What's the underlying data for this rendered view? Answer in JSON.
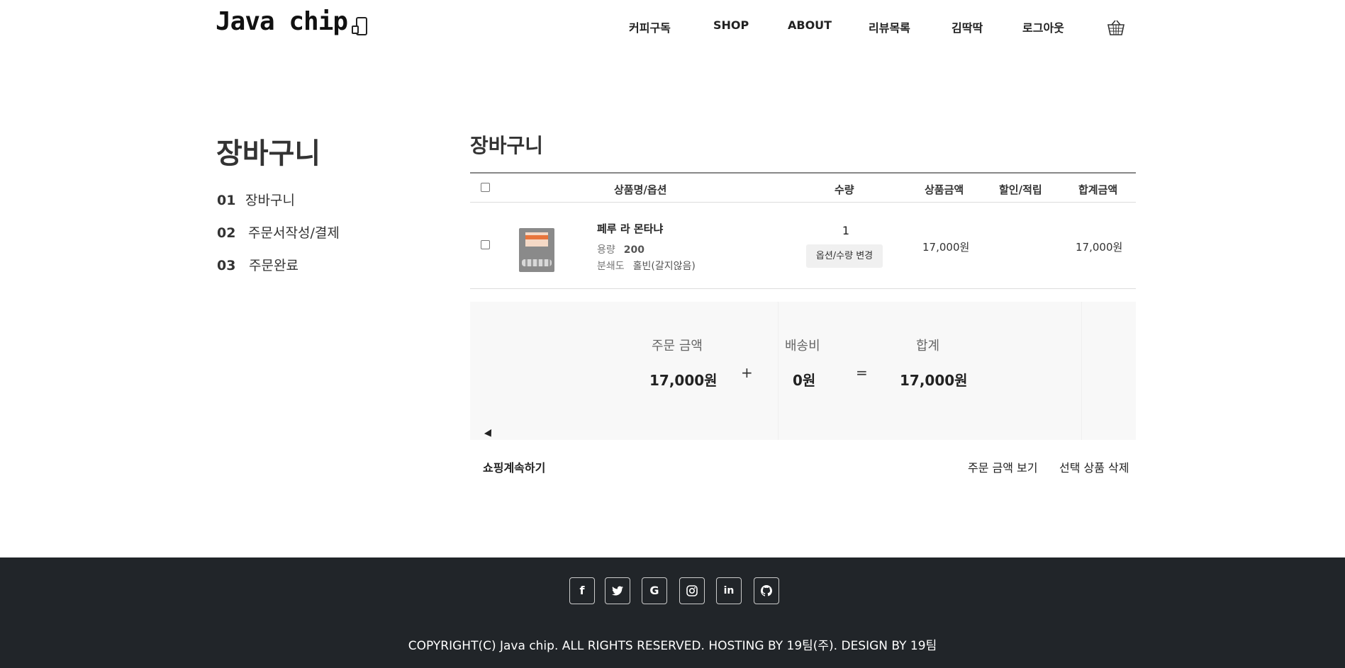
{
  "header": {
    "logo": "Java chip",
    "nav": [
      "커피구독",
      "SHOP",
      "ABOUT",
      "리뷰목록",
      "김딱딱",
      "로그아웃"
    ]
  },
  "sidebar": {
    "title": "장바구니",
    "steps": [
      {
        "num": "01",
        "label": "장바구니"
      },
      {
        "num": "02",
        "label": "주문서작성/결제"
      },
      {
        "num": "03",
        "label": "주문완료"
      }
    ]
  },
  "main": {
    "title": "장바구니",
    "columns": [
      "상품명/옵션",
      "수량",
      "상품금액",
      "할인/적립",
      "합계금액"
    ],
    "items": [
      {
        "name": "페루 라 몬타냐",
        "options": [
          {
            "label": "용량",
            "value": "200"
          },
          {
            "label": "분쇄도",
            "value": "홀빈(갈지않음)"
          }
        ],
        "quantity": "1",
        "option_button": "옵션/수량 변경",
        "price": "17,000원",
        "discount": "",
        "total": "17,000원"
      }
    ]
  },
  "summary": {
    "order_label": "주문 금액",
    "order_value": "17,000원",
    "plus": "+",
    "shipping_label": "배송비",
    "shipping_value": "0원",
    "equals": "=",
    "total_label": "합계",
    "total_value": "17,000원"
  },
  "actions": {
    "continue": "쇼핑계속하기",
    "view_amount": "주문 금액 보기",
    "delete_selected": "선택 상품 삭제"
  },
  "footer": {
    "social": [
      {
        "icon": "facebook-icon",
        "glyph": "f"
      },
      {
        "icon": "twitter-icon",
        "glyph": "🐦"
      },
      {
        "icon": "google-icon",
        "glyph": "G"
      },
      {
        "icon": "instagram-icon",
        "glyph": "◎"
      },
      {
        "icon": "linkedin-icon",
        "glyph": "in"
      },
      {
        "icon": "github-icon",
        "glyph": "⌬"
      }
    ],
    "copyright": "COPYRIGHT(C) Java chip. ALL RIGHTS RESERVED. HOSTING BY 19팀(주). DESIGN BY 19팀"
  },
  "colors": {
    "footer_bg": "#212529",
    "summary_bg": "#f8f8f8",
    "text": "#222222"
  }
}
